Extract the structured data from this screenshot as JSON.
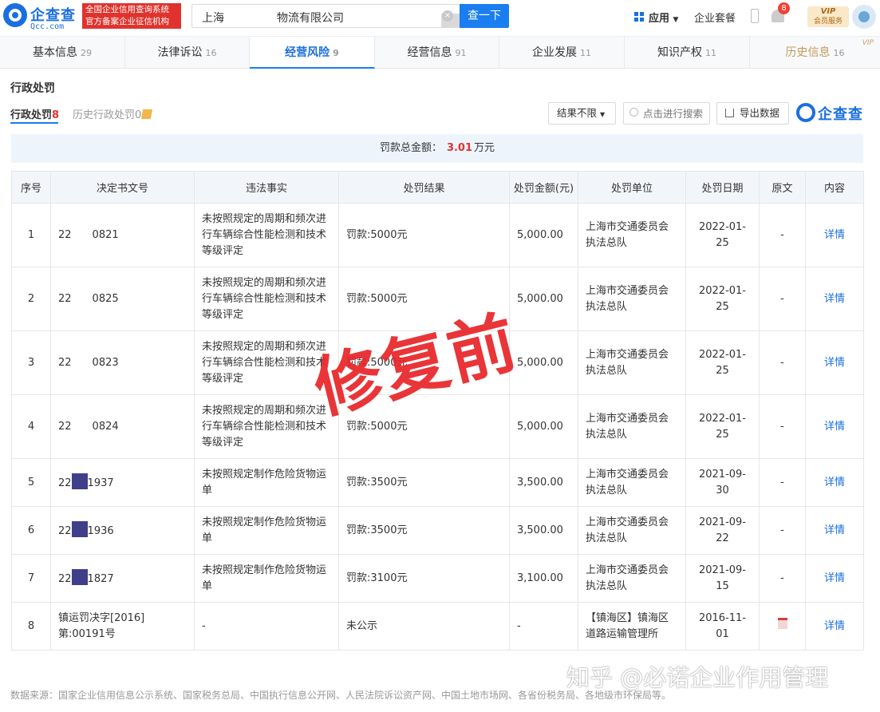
{
  "header": {
    "logo_cn": "企查查",
    "logo_en": "Qcc.com",
    "badge_line1": "全国企业信用查询系统",
    "badge_line2": "官方备案企业征信机构",
    "search_prefix": "上海",
    "search_suffix": "物流有限公司",
    "search_button": "查一下",
    "apps_label": "应用",
    "combo_label": "企业套餐",
    "notification_count": "8",
    "vip_title": "VIP",
    "vip_subtitle": "会员服务",
    "brand_color": "#1a6fe0"
  },
  "tabs": [
    {
      "label": "基本信息",
      "count": "29"
    },
    {
      "label": "法律诉讼",
      "count": "16"
    },
    {
      "label": "经营风险",
      "count": "9"
    },
    {
      "label": "经营信息",
      "count": "91"
    },
    {
      "label": "企业发展",
      "count": "11"
    },
    {
      "label": "知识产权",
      "count": "11"
    },
    {
      "label": "历史信息",
      "count": "16",
      "vip": "VIP"
    }
  ],
  "section": {
    "title": "行政处罚",
    "subtab_active": "行政处罚",
    "subtab_active_count": "8",
    "subtab_history": "历史行政处罚",
    "subtab_history_count": "0",
    "filter_label": "结果不限",
    "search_placeholder": "点击进行搜索",
    "export_label": "导出数据",
    "brand_text": "企查查"
  },
  "summary": {
    "label": "罚款总金额：",
    "amount": "3.01",
    "unit": "万元"
  },
  "table": {
    "headers": [
      "序号",
      "决定书文号",
      "违法事实",
      "处罚结果",
      "处罚金额(元)",
      "处罚单位",
      "处罚日期",
      "原文",
      "内容"
    ],
    "rows": [
      {
        "seq": "1",
        "doc_a": "22",
        "doc_b": "0821",
        "fact": "未按照规定的周期和频次进行车辆综合性能检测和技术等级评定",
        "result": "罚款:5000元",
        "amount": "5,000.00",
        "unit": "上海市交通委员会执法总队",
        "date": "2022-01-25",
        "orig": "-",
        "detail": "详情"
      },
      {
        "seq": "2",
        "doc_a": "22",
        "doc_b": "0825",
        "fact": "未按照规定的周期和频次进行车辆综合性能检测和技术等级评定",
        "result": "罚款:5000元",
        "amount": "5,000.00",
        "unit": "上海市交通委员会执法总队",
        "date": "2022-01-25",
        "orig": "-",
        "detail": "详情"
      },
      {
        "seq": "3",
        "doc_a": "22",
        "doc_b": "0823",
        "fact": "未按照规定的周期和频次进行车辆综合性能检测和技术等级评定",
        "result": "罚款:5000元",
        "amount": "5,000.00",
        "unit": "上海市交通委员会执法总队",
        "date": "2022-01-25",
        "orig": "-",
        "detail": "详情"
      },
      {
        "seq": "4",
        "doc_a": "22",
        "doc_b": "0824",
        "fact": "未按照规定的周期和频次进行车辆综合性能检测和技术等级评定",
        "result": "罚款:5000元",
        "amount": "5,000.00",
        "unit": "上海市交通委员会执法总队",
        "date": "2022-01-25",
        "orig": "-",
        "detail": "详情"
      },
      {
        "seq": "5",
        "doc_a": "22",
        "doc_b": "1937",
        "fact": "未按照规定制作危险货物运单",
        "result": "罚款:3500元",
        "amount": "3,500.00",
        "unit": "上海市交通委员会执法总队",
        "date": "2021-09-30",
        "orig": "-",
        "detail": "详情"
      },
      {
        "seq": "6",
        "doc_a": "22",
        "doc_b": "1936",
        "fact": "未按照规定制作危险货物运单",
        "result": "罚款:3500元",
        "amount": "3,500.00",
        "unit": "上海市交通委员会执法总队",
        "date": "2021-09-22",
        "orig": "-",
        "detail": "详情"
      },
      {
        "seq": "7",
        "doc_a": "22",
        "doc_b": "1827",
        "fact": "未按照规定制作危险货物运单",
        "result": "罚款:3100元",
        "amount": "3,100.00",
        "unit": "上海市交通委员会执法总队",
        "date": "2021-09-15",
        "orig": "-",
        "detail": "详情"
      },
      {
        "seq": "8",
        "doc_full": "镇运罚决字[2016]第:00191号",
        "fact": "-",
        "result": "未公示",
        "amount": "-",
        "unit": "【镇海区】镇海区道路运输管理所",
        "date": "2016-11-01",
        "detail": "详情"
      }
    ]
  },
  "overlay": {
    "stamp": "修复前",
    "watermark": "知乎 @必诺企业作用管理"
  },
  "footer": {
    "source": "数据来源：国家企业信用信息公示系统、国家税务总局、中国执行信息公开网、人民法院诉讼资产网、中国土地市场网、各省份税务局、各地级市环保局等。"
  }
}
